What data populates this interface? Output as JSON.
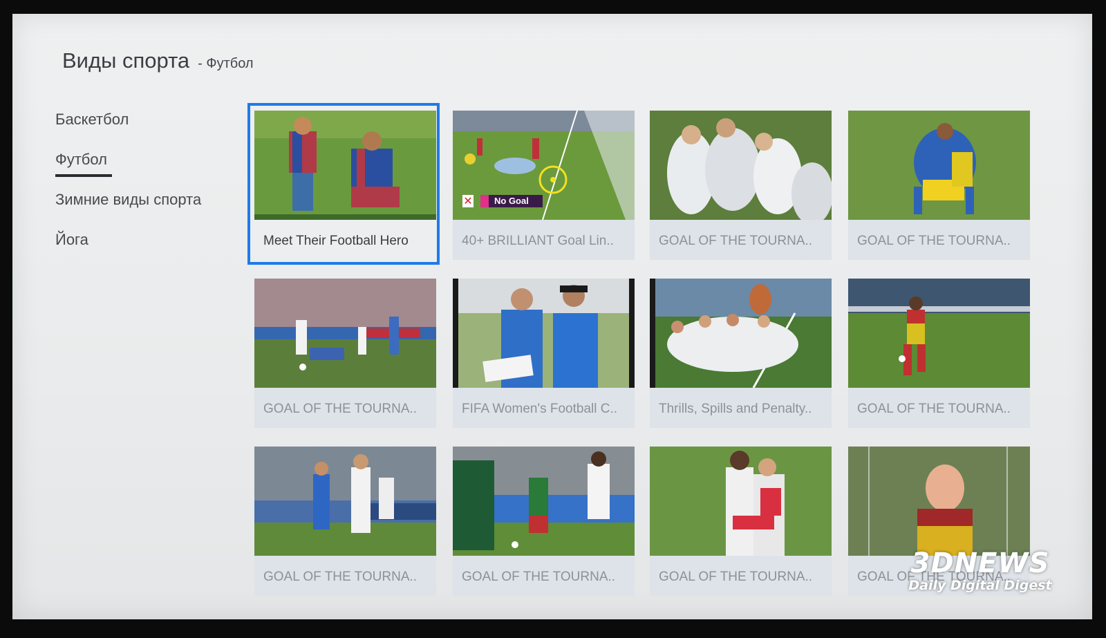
{
  "header": {
    "title": "Виды спорта",
    "subtitle": "- Футбол"
  },
  "sidebar": {
    "items": [
      {
        "label": "Баскетбол",
        "active": false
      },
      {
        "label": "Футбол",
        "active": true
      },
      {
        "label": "Зимние виды спорта",
        "active": false
      },
      {
        "label": "Йога",
        "active": false
      }
    ]
  },
  "videos": [
    {
      "title": "Meet Their Football Hero",
      "thumb": "boy-with-footballer"
    },
    {
      "title": "40+ BRILLIANT Goal Lin..",
      "thumb": "goal-line-clearance",
      "badge": "No Goal"
    },
    {
      "title": "GOAL OF THE TOURNA..",
      "thumb": "team-celebration-white"
    },
    {
      "title": "GOAL OF THE TOURNA..",
      "thumb": "players-celebrate-blue"
    },
    {
      "title": "GOAL OF THE TOURNA..",
      "thumb": "match-tackle"
    },
    {
      "title": "FIFA Women's Football C..",
      "thumb": "coaches-tactics"
    },
    {
      "title": "Thrills, Spills and Penalty..",
      "thumb": "team-photo-mascot"
    },
    {
      "title": "GOAL OF THE TOURNA..",
      "thumb": "player-shooting"
    },
    {
      "title": "GOAL OF THE TOURNA..",
      "thumb": "players-in-stadium"
    },
    {
      "title": "GOAL OF THE TOURNA..",
      "thumb": "players-running"
    },
    {
      "title": "GOAL OF THE TOURNA..",
      "thumb": "players-hug"
    },
    {
      "title": "GOAL OF THE TOURNA..",
      "thumb": "goalkeeper-closeup"
    }
  ],
  "watermark": {
    "brand": "3DNEWS",
    "tagline": "Daily Digital Digest"
  },
  "colors": {
    "focus": "#1f7ae8",
    "pitch": "#5f8b3a",
    "caption_bg": "#dde3e8"
  }
}
